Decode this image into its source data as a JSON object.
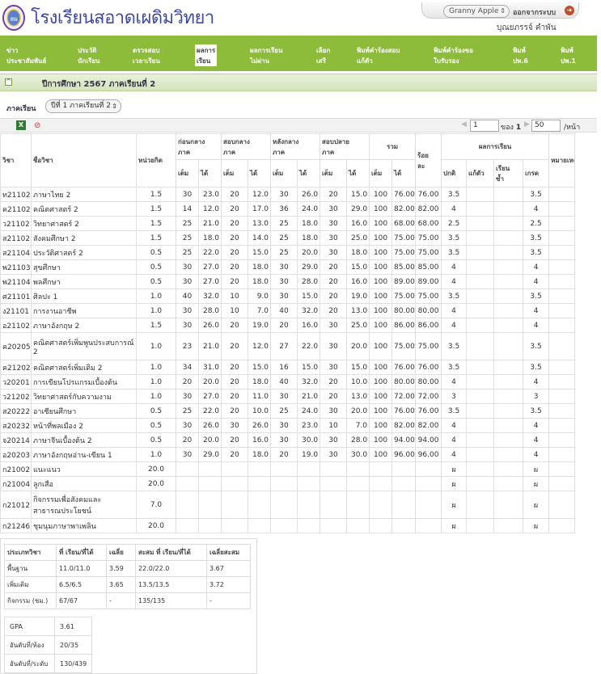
{
  "header": {
    "school_name": "โรงเรียนสอาดเผดิมวิทยา",
    "user_select": "Granny Apple",
    "logout_label": "ออกจากระบบ",
    "username": "บุณยภรรจ์ คำพัน"
  },
  "nav": [
    {
      "label": "ข่าว\nประชาสัมพันธ์",
      "active": false
    },
    {
      "label": "ประวัติ\nนักเรียน",
      "active": false
    },
    {
      "label": "ตรวจสอบ\nเวลาเรียน",
      "active": false
    },
    {
      "label": "ผลการ\nเรียน",
      "active": true
    },
    {
      "label": "ผลการเรียน\nไม่ผ่าน",
      "active": false
    },
    {
      "label": "เลือก\nเสรี",
      "active": false
    },
    {
      "label": "พิมพ์คำร้องสอบ\nแก้ตัว",
      "active": false
    },
    {
      "label": "พิมพ์คำร้องขอ\nใบรับรอง",
      "active": false
    },
    {
      "label": "พิมพ์\nปพ.6",
      "active": false
    },
    {
      "label": "พิมพ์\nปพ.1",
      "active": false
    }
  ],
  "year_title": "ปีการศึกษา 2567 ภาคเรียนที่ 2",
  "term": {
    "label": "ภาคเรียน",
    "selected": "ปีที่ 1 ภาคเรียนที่ 2"
  },
  "pager": {
    "page": "1",
    "of_label": "ของ",
    "total": "1",
    "per_page": "50",
    "per_page_label": "/หน้า"
  },
  "table": {
    "headers": {
      "subject_code": "วิชา",
      "subject_name": "ชื่อวิชา",
      "credits": "หน่วยกิต",
      "before_mid": "ก่อนกลาง\nภาค",
      "midterm": "สอบกลาง\nภาค",
      "after_mid": "หลังกลาง\nภาค",
      "final": "สอบปลาย\nภาค",
      "total": "รวม",
      "percent": "ร้อย\nละ",
      "result": "ผลการเรียน",
      "note": "หมายเหตุ",
      "full": "เต็ม",
      "got": "ได้",
      "normal": "ปกติ",
      "retest": "แก้ตัว",
      "repeat": "เรียน\nซ้ำ",
      "grade": "เกรด"
    },
    "rows": [
      [
        "ท21102",
        "ภาษาไทย 2",
        "1.5",
        "30",
        "23.0",
        "20",
        "12.0",
        "30",
        "26.0",
        "20",
        "15.0",
        "100",
        "76.00",
        "76.00",
        "3.5",
        "",
        "",
        "3.5",
        ""
      ],
      [
        "ค21102",
        "คณิตศาสตร์ 2",
        "1.5",
        "14",
        "12.0",
        "20",
        "17.0",
        "36",
        "24.0",
        "30",
        "29.0",
        "100",
        "82.00",
        "82.00",
        "4",
        "",
        "",
        "4",
        ""
      ],
      [
        "ว21102",
        "วิทยาศาสตร์ 2",
        "1.5",
        "25",
        "21.0",
        "20",
        "13.0",
        "25",
        "18.0",
        "30",
        "16.0",
        "100",
        "68.00",
        "68.00",
        "2.5",
        "",
        "",
        "2.5",
        ""
      ],
      [
        "ส21102",
        "สังคมศึกษา 2",
        "1.5",
        "25",
        "18.0",
        "20",
        "14.0",
        "25",
        "18.0",
        "30",
        "25.0",
        "100",
        "75.00",
        "75.00",
        "3.5",
        "",
        "",
        "3.5",
        ""
      ],
      [
        "ส21104",
        "ประวัติศาสตร์ 2",
        "0.5",
        "25",
        "22.0",
        "20",
        "15.0",
        "25",
        "20.0",
        "30",
        "18.0",
        "100",
        "75.00",
        "75.00",
        "3.5",
        "",
        "",
        "3.5",
        ""
      ],
      [
        "พ21103",
        "สุขศึกษา",
        "0.5",
        "30",
        "27.0",
        "20",
        "18.0",
        "30",
        "29.0",
        "20",
        "15.0",
        "100",
        "85.00",
        "85.00",
        "4",
        "",
        "",
        "4",
        ""
      ],
      [
        "พ21104",
        "พลศึกษา",
        "0.5",
        "30",
        "27.0",
        "20",
        "18.0",
        "30",
        "28.0",
        "20",
        "16.0",
        "100",
        "89.00",
        "89.00",
        "4",
        "",
        "",
        "4",
        ""
      ],
      [
        "ศ21101",
        "ศิลปะ 1",
        "1.0",
        "40",
        "32.0",
        "10",
        "9.0",
        "30",
        "15.0",
        "20",
        "19.0",
        "100",
        "75.00",
        "75.00",
        "3.5",
        "",
        "",
        "3.5",
        ""
      ],
      [
        "ง21101",
        "การงานอาชีพ",
        "1.0",
        "30",
        "28.0",
        "10",
        "7.0",
        "40",
        "32.0",
        "20",
        "13.0",
        "100",
        "80.00",
        "80.00",
        "4",
        "",
        "",
        "4",
        ""
      ],
      [
        "อ21102",
        "ภาษาอังกฤษ 2",
        "1.5",
        "30",
        "26.0",
        "20",
        "19.0",
        "20",
        "16.0",
        "30",
        "25.0",
        "100",
        "86.00",
        "86.00",
        "4",
        "",
        "",
        "4",
        ""
      ],
      [
        "ค20205",
        "คณิตศาสตร์เพิ่มพูนประสบการณ์\n2",
        "1.0",
        "23",
        "21.0",
        "20",
        "12.0",
        "27",
        "22.0",
        "30",
        "20.0",
        "100",
        "75.00",
        "75.00",
        "3.5",
        "",
        "",
        "3.5",
        ""
      ],
      [
        "ค21202",
        "คณิตศาสตร์เพิ่มเติม 2",
        "1.0",
        "34",
        "31.0",
        "20",
        "15.0",
        "16",
        "15.0",
        "30",
        "15.0",
        "100",
        "76.00",
        "76.00",
        "3.5",
        "",
        "",
        "3.5",
        ""
      ],
      [
        "ว20201",
        "การเขียนโปรแกรมเบื้องต้น",
        "1.0",
        "20",
        "20.0",
        "20",
        "18.0",
        "40",
        "32.0",
        "20",
        "10.0",
        "100",
        "80.00",
        "80.00",
        "4",
        "",
        "",
        "4",
        ""
      ],
      [
        "ว21202",
        "วิทยาศาสตร์กับความงาม",
        "1.0",
        "30",
        "27.0",
        "20",
        "11.0",
        "30",
        "21.0",
        "20",
        "13.0",
        "100",
        "72.00",
        "72.00",
        "3",
        "",
        "",
        "3",
        ""
      ],
      [
        "ส20222",
        "อาเซียนศึกษา",
        "0.5",
        "25",
        "22.0",
        "20",
        "10.0",
        "25",
        "24.0",
        "30",
        "20.0",
        "100",
        "76.00",
        "76.00",
        "3.5",
        "",
        "",
        "3.5",
        ""
      ],
      [
        "ส20232",
        "หน้าที่พลเมือง 2",
        "0.5",
        "30",
        "26.0",
        "30",
        "26.0",
        "30",
        "23.0",
        "10",
        "7.0",
        "100",
        "82.00",
        "82.00",
        "4",
        "",
        "",
        "4",
        ""
      ],
      [
        "จ20214",
        "ภาษาจีนเบื้องต้น 2",
        "0.5",
        "20",
        "20.0",
        "20",
        "16.0",
        "30",
        "30.0",
        "30",
        "28.0",
        "100",
        "94.00",
        "94.00",
        "4",
        "",
        "",
        "4",
        ""
      ],
      [
        "อ20203",
        "ภาษาอังกฤษอ่าน-เขียน 1",
        "1.0",
        "30",
        "29.0",
        "20",
        "18.0",
        "20",
        "19.0",
        "30",
        "30.0",
        "100",
        "96.00",
        "96.00",
        "4",
        "",
        "",
        "4",
        ""
      ],
      [
        "ก21002",
        "แนะแนว",
        "20.0",
        "",
        "",
        "",
        "",
        "",
        "",
        "",
        "",
        "",
        "",
        "",
        "ผ",
        "",
        "",
        "ผ",
        ""
      ],
      [
        "ก21004",
        "ลูกเสือ",
        "20.0",
        "",
        "",
        "",
        "",
        "",
        "",
        "",
        "",
        "",
        "",
        "",
        "ผ",
        "",
        "",
        "ผ",
        ""
      ],
      [
        "ก21012",
        "กิจกรรมเพื่อสังคมและ\nสาธารณประโยชน์",
        "7.0",
        "",
        "",
        "",
        "",
        "",
        "",
        "",
        "",
        "",
        "",
        "",
        "ผ",
        "",
        "",
        "ผ",
        ""
      ],
      [
        "ก21246",
        "ชุมนุมภาษาพาเพลิน",
        "20.0",
        "",
        "",
        "",
        "",
        "",
        "",
        "",
        "",
        "",
        "",
        "",
        "ผ",
        "",
        "",
        "ผ",
        ""
      ]
    ]
  },
  "summary": {
    "headers": [
      "ประเภทวิชา",
      "ที่ เรียน/ที่ได้",
      "เฉลี่ย",
      "สะสม ที่ เรียน/ที่ได้",
      "เฉลี่ยสะสม"
    ],
    "rows": [
      [
        "พื้นฐาน",
        "11.0/11.0",
        "3.59",
        "22.0/22.0",
        "3.67"
      ],
      [
        "เพิ่มเติม",
        "6.5/6.5",
        "3.65",
        "13.5/13.5",
        "3.72"
      ],
      [
        "กิจกรรม (ชม.)",
        "67/67",
        "-",
        "135/135",
        "-"
      ]
    ]
  },
  "gpa": [
    [
      "GPA",
      "3.61"
    ],
    [
      "อันดับที่/ห้อง",
      "20/35"
    ],
    [
      "อันดับที่/ระดับ",
      "130/439"
    ]
  ],
  "colors": {
    "nav": "#8cbc3a",
    "school_name": "#3f4aa0"
  }
}
